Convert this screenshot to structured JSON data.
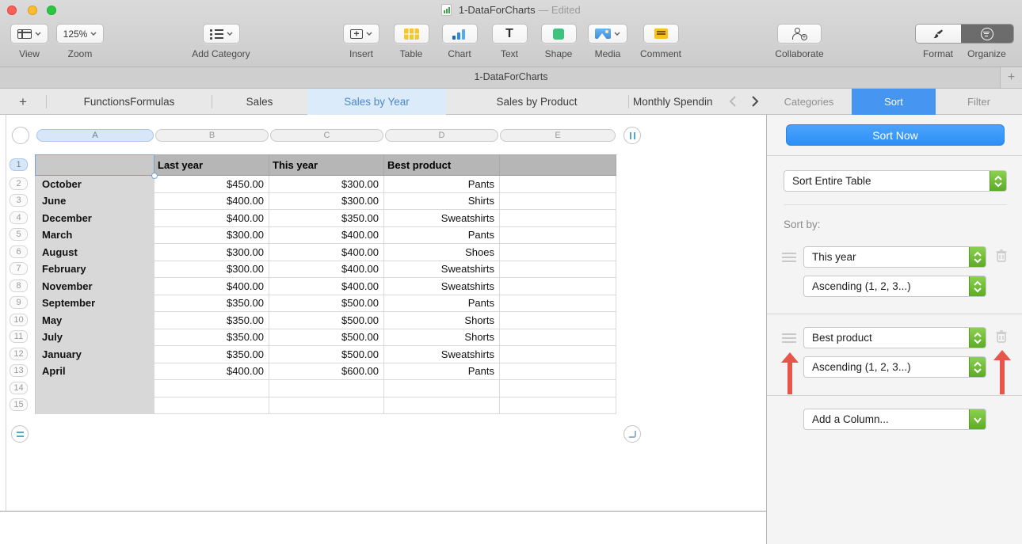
{
  "window": {
    "title": "1-DataForCharts",
    "title_suffix": "— Edited",
    "subtitle": "1-DataForCharts",
    "add_sheet_button": "+"
  },
  "toolbar": {
    "view": {
      "label": "View"
    },
    "zoom": {
      "label": "Zoom",
      "value": "125%"
    },
    "add_category": {
      "label": "Add Category"
    },
    "insert": {
      "label": "Insert"
    },
    "table": {
      "label": "Table"
    },
    "chart": {
      "label": "Chart"
    },
    "text": {
      "label": "Text",
      "glyph": "T"
    },
    "shape": {
      "label": "Shape"
    },
    "media": {
      "label": "Media"
    },
    "comment": {
      "label": "Comment"
    },
    "collaborate": {
      "label": "Collaborate"
    },
    "format": {
      "label": "Format"
    },
    "organize": {
      "label": "Organize"
    }
  },
  "sheet_tabs": {
    "add": "+",
    "tabs": [
      {
        "label": "FunctionsFormulas",
        "selected": false
      },
      {
        "label": "Sales",
        "selected": false
      },
      {
        "label": "Sales by Year",
        "selected": true
      },
      {
        "label": "Sales by Product",
        "selected": false
      },
      {
        "label": "Monthly Spendin",
        "selected": false
      }
    ]
  },
  "panel_tabs": [
    {
      "label": "Categories",
      "selected": false
    },
    {
      "label": "Sort",
      "selected": true
    },
    {
      "label": "Filter",
      "selected": false
    }
  ],
  "sort_panel": {
    "sort_now": "Sort Now",
    "scope": "Sort Entire Table",
    "sort_by_label": "Sort by:",
    "rules": [
      {
        "column": "This year",
        "order": "Ascending (1, 2, 3...)"
      },
      {
        "column": "Best product",
        "order": "Ascending (1, 2, 3...)"
      }
    ],
    "add_column": "Add a Column..."
  },
  "spreadsheet": {
    "column_letters": [
      "A",
      "B",
      "C",
      "D",
      "E"
    ],
    "header_row": [
      "",
      "Last year",
      "This year",
      "Best product",
      ""
    ],
    "rows": [
      [
        "October",
        "$450.00",
        "$300.00",
        "Pants",
        ""
      ],
      [
        "June",
        "$400.00",
        "$300.00",
        "Shirts",
        ""
      ],
      [
        "December",
        "$400.00",
        "$350.00",
        "Sweatshirts",
        ""
      ],
      [
        "March",
        "$300.00",
        "$400.00",
        "Pants",
        ""
      ],
      [
        "August",
        "$300.00",
        "$400.00",
        "Shoes",
        ""
      ],
      [
        "February",
        "$300.00",
        "$400.00",
        "Sweatshirts",
        ""
      ],
      [
        "November",
        "$400.00",
        "$400.00",
        "Sweatshirts",
        ""
      ],
      [
        "September",
        "$350.00",
        "$500.00",
        "Pants",
        ""
      ],
      [
        "May",
        "$350.00",
        "$500.00",
        "Shorts",
        ""
      ],
      [
        "July",
        "$350.00",
        "$500.00",
        "Shorts",
        ""
      ],
      [
        "January",
        "$350.00",
        "$500.00",
        "Sweatshirts",
        ""
      ],
      [
        "April",
        "$400.00",
        "$600.00",
        "Pants",
        ""
      ],
      [
        "",
        "",
        "",
        "",
        ""
      ],
      [
        "",
        "",
        "",
        "",
        ""
      ]
    ],
    "row_count": 15
  },
  "icons": {
    "view": "window-panes-icon",
    "add_category": "bulleted-list-icon",
    "insert": "plus-box-icon",
    "table": "yellow-grid-icon",
    "chart": "bar-chart-icon",
    "text": "letter-T-icon",
    "shape": "green-square-icon",
    "media": "photo-icon",
    "comment": "speech-note-icon",
    "collaborate": "person-plus-icon",
    "format": "paintbrush-icon",
    "organize": "circle-lines-icon",
    "dropdown_stepper": "green-up-down-chevrons",
    "trash": "trash-can-icon",
    "drag_handle": "three-lines-handle",
    "annotation": "red-up-arrow"
  },
  "colors": {
    "accent_blue": "#2f8ff6",
    "selected_tab_blue": "#4695f0",
    "stepper_green": "#5cab27",
    "annotation_red": "#e8554a",
    "header_row_gray": "#b6b6b6",
    "header_col_gray": "#d8d8d8"
  }
}
